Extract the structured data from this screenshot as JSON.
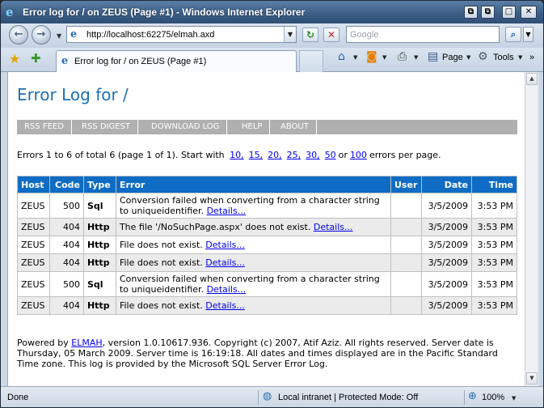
{
  "window": {
    "title": "Error log for / on ZEUS (Page #1) - Windows Internet Explorer",
    "buttons": {
      "restore": "⧉",
      "minimize": "_",
      "maximize": "□",
      "close": "✕",
      "sizer": "⧉"
    }
  },
  "navigation": {
    "back": "←",
    "forward": "→",
    "address_url": "http://localhost:62275/elmah.axd",
    "refresh": "↻",
    "stop": "✕",
    "search_placeholder": "Google"
  },
  "tab": {
    "label": "Error log for / on ZEUS (Page #1)"
  },
  "commands": {
    "page": "Page",
    "tools": "Tools",
    "more": "»"
  },
  "page": {
    "title": "Error Log for /",
    "speedbar": [
      "RSS FEED",
      "RSS DIGEST",
      "DOWNLOAD LOG",
      "HELP",
      "ABOUT"
    ],
    "intro_prefix": "Errors 1 to 6 of total 6 (page 1 of 1). Start with",
    "page_sizes": [
      "10,",
      "15,",
      "20,",
      "25,",
      "30,",
      "50"
    ],
    "intro_or": "or",
    "page_size_last": "100",
    "intro_suffix": "errors per page.",
    "columns": [
      "Host",
      "Code",
      "Type",
      "Error",
      "User",
      "Date",
      "Time"
    ],
    "rows": [
      {
        "host": "ZEUS",
        "code": "500",
        "type": "Sql",
        "error": "Conversion failed when converting from a character string to uniqueidentifier.",
        "detail": "Details...",
        "user": "",
        "date": "3/5/2009",
        "time": "3:53 PM"
      },
      {
        "host": "ZEUS",
        "code": "404",
        "type": "Http",
        "error": "The file '/NoSuchPage.aspx' does not exist.",
        "detail": "Details...",
        "user": "",
        "date": "3/5/2009",
        "time": "3:53 PM"
      },
      {
        "host": "ZEUS",
        "code": "404",
        "type": "Http",
        "error": "File does not exist.",
        "detail": "Details...",
        "user": "",
        "date": "3/5/2009",
        "time": "3:53 PM"
      },
      {
        "host": "ZEUS",
        "code": "404",
        "type": "Http",
        "error": "File does not exist.",
        "detail": "Details...",
        "user": "",
        "date": "3/5/2009",
        "time": "3:53 PM"
      },
      {
        "host": "ZEUS",
        "code": "500",
        "type": "Sql",
        "error": "Conversion failed when converting from a character string to uniqueidentifier.",
        "detail": "Details...",
        "user": "",
        "date": "3/5/2009",
        "time": "3:53 PM"
      },
      {
        "host": "ZEUS",
        "code": "404",
        "type": "Http",
        "error": "File does not exist.",
        "detail": "Details...",
        "user": "",
        "date": "3/5/2009",
        "time": "3:53 PM"
      }
    ],
    "footer_prefix": "Powered by",
    "footer_link": "ELMAH",
    "footer_text": ", version 1.0.10617.936. Copyright (c) 2007, Atif Aziz. All rights reserved. Server date is Thursday, 05 March 2009. Server time is 16:19:18. All dates and times displayed are in the Pacific Standard Time zone. This log is provided by the Microsoft SQL Server Error Log."
  },
  "status": {
    "done": "Done",
    "zone": "Local intranet | Protected Mode: Off",
    "zoom": "100%"
  },
  "colors": {
    "accent": "#1e6fb6",
    "table_header": "#0f6cc4",
    "speedbar": "#b0b0b0",
    "link": "#0000ee"
  }
}
